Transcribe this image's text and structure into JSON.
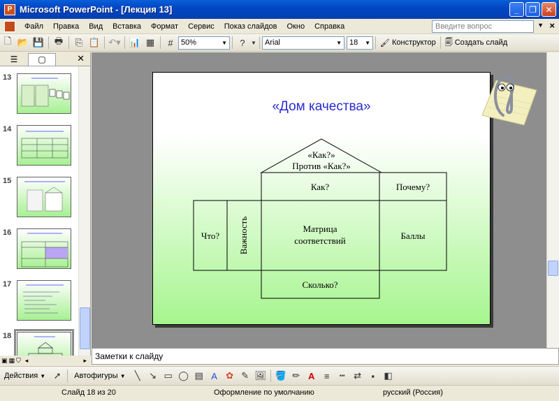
{
  "window": {
    "title": "Microsoft PowerPoint - [Лекция 13]"
  },
  "menu": {
    "items": [
      "Файл",
      "Правка",
      "Вид",
      "Вставка",
      "Формат",
      "Сервис",
      "Показ слайдов",
      "Окно",
      "Справка"
    ],
    "help_placeholder": "Введите вопрос"
  },
  "toolbar": {
    "zoom": "50%",
    "font": "Arial",
    "font_size": "18",
    "designer": "Конструктор",
    "new_slide": "Создать слайд"
  },
  "thumbnails": [
    {
      "num": "13"
    },
    {
      "num": "14"
    },
    {
      "num": "15"
    },
    {
      "num": "16"
    },
    {
      "num": "17"
    },
    {
      "num": "18"
    }
  ],
  "slide": {
    "title": "«Дом качества»",
    "house": {
      "roof": "«Как?»\nПротив «Как?»",
      "how": "Как?",
      "why": "Почему?",
      "what": "Что?",
      "importance": "Важность",
      "matrix": "Матрица\nсоответствий",
      "score": "Баллы",
      "howmuch": "Сколько?"
    }
  },
  "notes": {
    "placeholder": "Заметки к слайду"
  },
  "drawing": {
    "actions": "Действия",
    "autoshapes": "Автофигуры"
  },
  "status": {
    "slide": "Слайд 18 из 20",
    "design": "Оформление по умолчанию",
    "language": "русский (Россия)"
  },
  "colors": {
    "title_blue": "#2a2cd0",
    "slide_green": "#a6f58e",
    "titlebar": "#0346c4"
  }
}
